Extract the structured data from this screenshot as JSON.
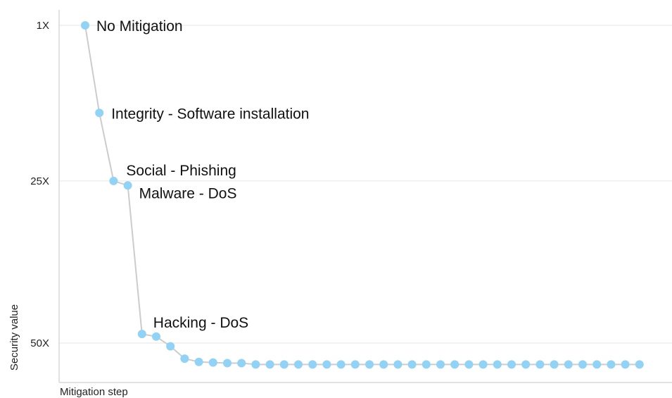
{
  "chart_data": {
    "type": "line",
    "title": "",
    "xlabel": "Mitigation step",
    "ylabel": "Security value",
    "y_ticks": [
      "1X",
      "25X",
      "50X"
    ],
    "y_tick_values": [
      1,
      25,
      50
    ],
    "ylim": [
      -1.3,
      56
    ],
    "grid": "horizontal",
    "series_color": "#92d3f5",
    "line_color": "#cccccc",
    "x": [
      1,
      2,
      3,
      4,
      5,
      6,
      7,
      8,
      9,
      10,
      11,
      12,
      13,
      14,
      15,
      16,
      17,
      18,
      19,
      20,
      21,
      22,
      23,
      24,
      25,
      26,
      27,
      28,
      29,
      30,
      30,
      31,
      32,
      33,
      34,
      35,
      36,
      37,
      38,
      39,
      40
    ],
    "values": [
      1,
      14.5,
      25,
      25.7,
      48.6,
      49,
      50.5,
      52.4,
      52.9,
      53,
      53.1,
      53.1,
      53.3,
      53.3,
      53.3,
      53.3,
      53.3,
      53.3,
      53.3,
      53.3,
      53.3,
      53.3,
      53.3,
      53.3,
      53.3,
      53.3,
      53.3,
      53.3,
      53.3,
      53.3,
      53.3,
      53.3,
      53.3,
      53.3,
      53.3,
      53.3,
      53.3,
      53.3,
      53.3,
      53.3
    ],
    "annotations": [
      {
        "text": "No Mitigation",
        "index": 0
      },
      {
        "text": "Integrity - Software installation",
        "index": 1
      },
      {
        "text": "Social - Phishing",
        "index": 2
      },
      {
        "text": "Malware - DoS",
        "index": 3
      },
      {
        "text": "Hacking - DoS",
        "index": 4
      }
    ]
  }
}
